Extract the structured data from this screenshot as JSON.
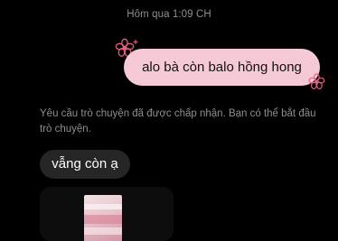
{
  "conversation": {
    "timestamp": "Hôm qua 1:09 CH",
    "messages": [
      {
        "direction": "outgoing",
        "text": "alo bà còn balo hồng hong"
      },
      {
        "direction": "system",
        "text": "Yêu cầu trò chuyện đã được chấp nhận. Bạn có thể bắt đầu trò chuyện."
      },
      {
        "direction": "incoming",
        "text": "vẫng còn ạ"
      },
      {
        "direction": "incoming",
        "type": "image"
      }
    ]
  },
  "colors": {
    "background": "#000000",
    "outgoing_bubble": "#f6c9d6",
    "incoming_bubble": "#262626",
    "muted_text": "#8e8e93",
    "sticker_pink": "#e0607e"
  },
  "icons": {
    "sticker": "flower-doodle-icon"
  }
}
